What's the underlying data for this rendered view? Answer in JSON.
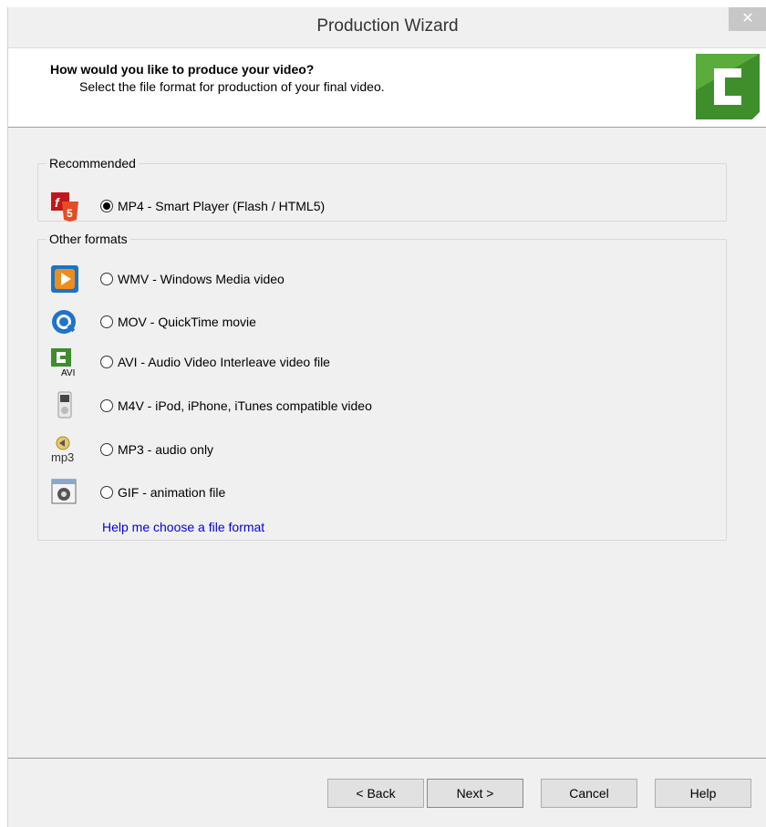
{
  "window": {
    "title": "Production Wizard",
    "close_glyph": "✕"
  },
  "header": {
    "title": "How would you like to produce your video?",
    "subtitle": "Select the file format for production of your final video.",
    "logo_icon": "camtasia-logo-icon"
  },
  "recommended": {
    "label": "Recommended",
    "options": [
      {
        "label": "MP4 - Smart Player (Flash / HTML5)",
        "icon": "html5-flash-icon",
        "checked": true
      }
    ]
  },
  "other": {
    "label": "Other formats",
    "options": [
      {
        "label": "WMV - Windows Media video",
        "icon": "windows-media-icon",
        "checked": false
      },
      {
        "label": "MOV - QuickTime movie",
        "icon": "quicktime-icon",
        "checked": false
      },
      {
        "label": "AVI - Audio Video Interleave video file",
        "icon": "avi-icon",
        "checked": false,
        "icon_text": "AVI"
      },
      {
        "label": "M4V - iPod, iPhone, iTunes compatible video",
        "icon": "ipod-icon",
        "checked": false
      },
      {
        "label": "MP3 - audio only",
        "icon": "mp3-icon",
        "checked": false,
        "icon_text": "mp3"
      },
      {
        "label": "GIF - animation file",
        "icon": "gif-animation-icon",
        "checked": false
      }
    ],
    "help_link": "Help me choose a file format"
  },
  "buttons": {
    "back": "< Back",
    "next": "Next >",
    "cancel": "Cancel",
    "help": "Help"
  },
  "colors": {
    "link": "#0000ee",
    "accent_green": "#3e8e2c",
    "html5_orange": "#e44d26",
    "flash_red": "#c3161c"
  }
}
